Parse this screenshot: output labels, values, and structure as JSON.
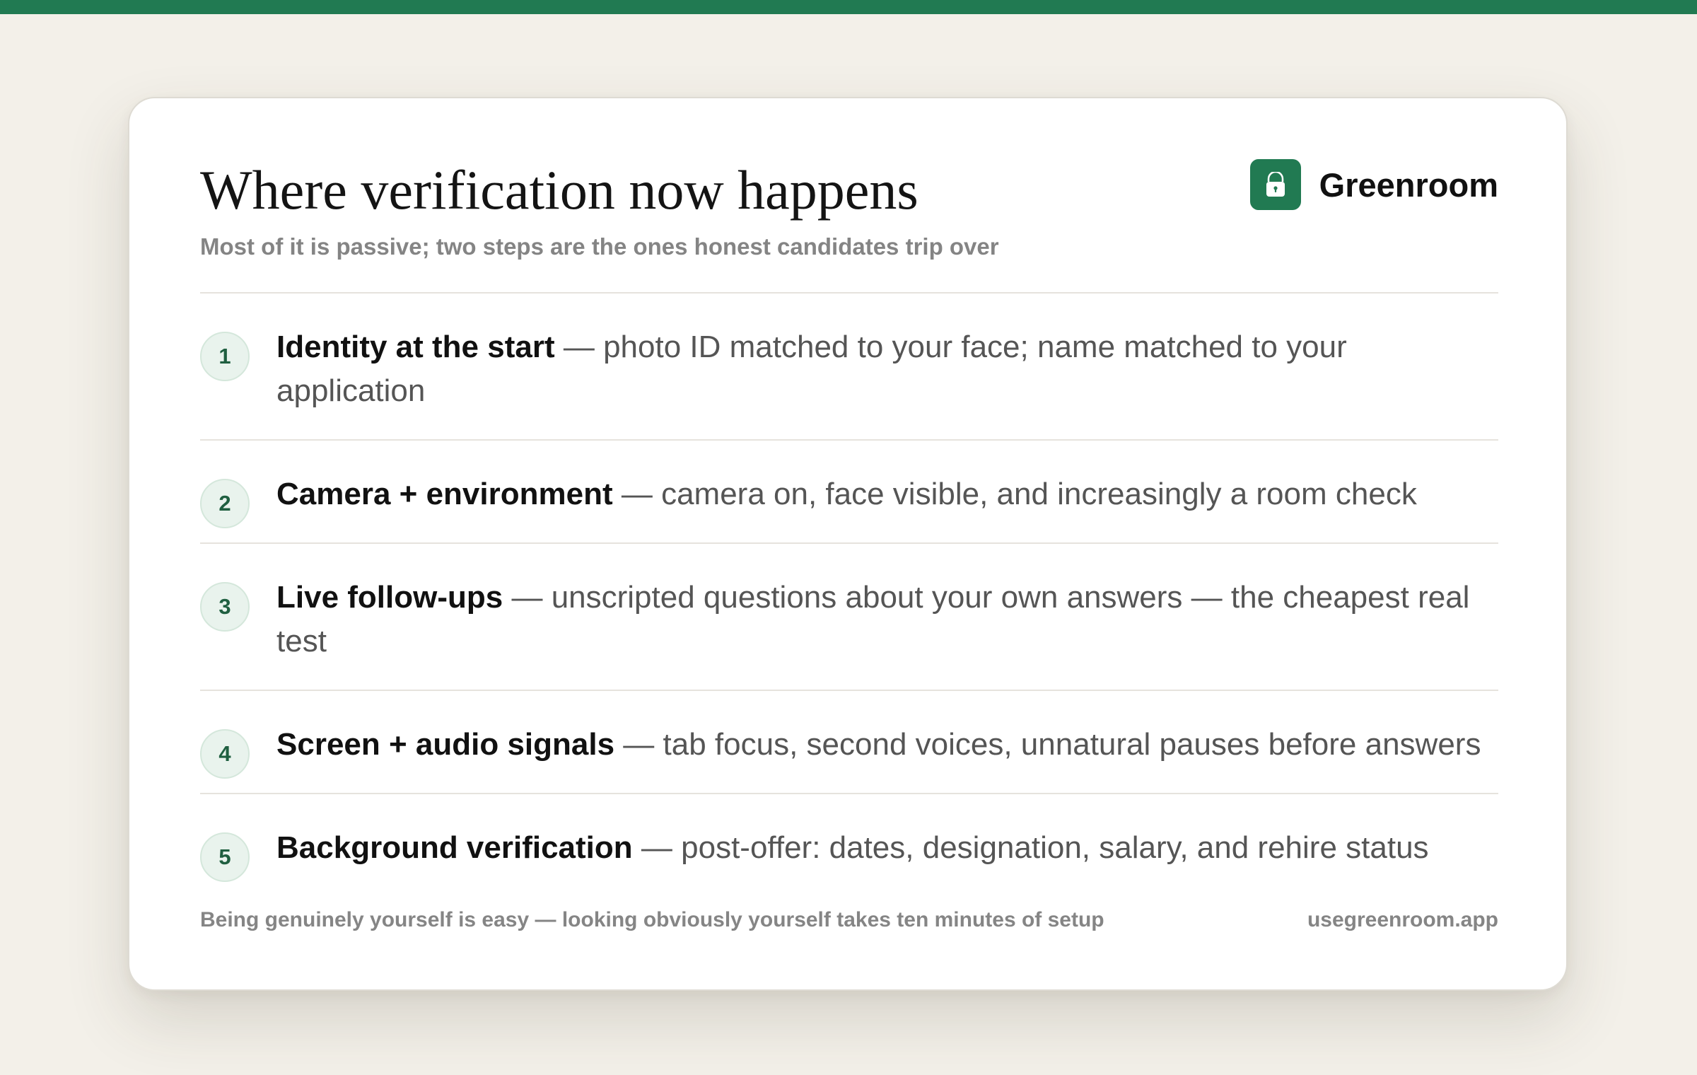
{
  "header": {
    "title": "Where verification now happens",
    "subtitle": "Most of it is passive; two steps are the ones honest candidates trip over"
  },
  "brand": {
    "name": "Greenroom",
    "logo_icon": "lock-icon",
    "accent_color": "#217a52"
  },
  "steps": [
    {
      "number": "1",
      "label": "Identity at the start",
      "separator": " — ",
      "description": "photo ID matched to your face; name matched to your application"
    },
    {
      "number": "2",
      "label": "Camera + environment",
      "separator": " — ",
      "description": "camera on, face visible, and increasingly a room check"
    },
    {
      "number": "3",
      "label": "Live follow-ups",
      "separator": " — ",
      "description": "unscripted questions about your own answers — the cheapest real test"
    },
    {
      "number": "4",
      "label": "Screen + audio signals",
      "separator": " — ",
      "description": "tab focus, second voices, unnatural pauses before answers"
    },
    {
      "number": "5",
      "label": "Background verification",
      "separator": " — ",
      "description": "post-offer: dates, designation, salary, and rehire status"
    }
  ],
  "footer": {
    "note": "Being genuinely yourself is easy — looking obviously yourself takes ten minutes of setup",
    "url": "usegreenroom.app"
  }
}
